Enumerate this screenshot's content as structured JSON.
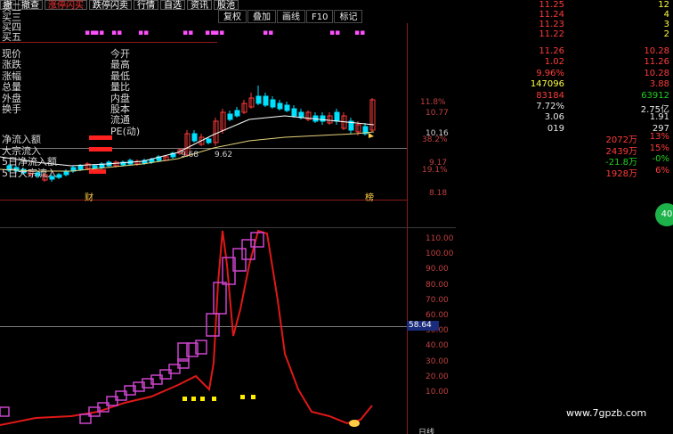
{
  "toolbar": {
    "buttons": [
      {
        "label": "撤",
        "red": false
      },
      {
        "label": "撤查",
        "red": false
      },
      {
        "label": "涨停闪买",
        "red": true
      },
      {
        "label": "跌停闪卖",
        "red": false
      },
      {
        "label": "行情",
        "red": false
      },
      {
        "label": "自选",
        "red": false
      },
      {
        "label": "资讯",
        "red": false
      },
      {
        "label": "股池",
        "red": false
      }
    ],
    "sub_buttons": [
      "复权",
      "叠加",
      "画线",
      "F10",
      "标记"
    ]
  },
  "price_axis": [
    "11.8%",
    "10.77",
    "10.16",
    "38.2%",
    "9.17",
    "19.1%",
    "8.18"
  ],
  "ma_labels": [
    "9.68",
    "9.62"
  ],
  "markers": {
    "left": "财",
    "right": "榜"
  },
  "lower_axis": [
    "110.00",
    "100.00",
    "90.00",
    "80.00",
    "70.00",
    "60.00",
    "50.00",
    "40.00",
    "30.00",
    "20.00",
    "10.00"
  ],
  "lower_highlight": "58.64",
  "lower_footer": "日线",
  "quote": {
    "bids": [
      {
        "label": "买二",
        "price": "11.25",
        "vol": "12"
      },
      {
        "label": "买三",
        "price": "11.24",
        "vol": "4"
      },
      {
        "label": "买四",
        "price": "11.23",
        "vol": "3"
      },
      {
        "label": "买五",
        "price": "11.22",
        "vol": "2"
      }
    ],
    "rows": [
      {
        "l1": "现价",
        "v1": "11.26",
        "c1": "red",
        "l2": "今开",
        "v2": "10.28",
        "c2": "red"
      },
      {
        "l1": "涨跌",
        "v1": "1.02",
        "c1": "red",
        "l2": "最高",
        "v2": "11.26",
        "c2": "red"
      },
      {
        "l1": "涨幅",
        "v1": "9.96%",
        "c1": "red",
        "l2": "最低",
        "v2": "10.28",
        "c2": "red"
      },
      {
        "l1": "总量",
        "v1": "147096",
        "c1": "yellow",
        "l2": "量比",
        "v2": "3.88",
        "c2": "red"
      },
      {
        "l1": "外盘",
        "v1": "83184",
        "c1": "red",
        "l2": "内盘",
        "v2": "63912",
        "c2": "green"
      },
      {
        "l1": "换手",
        "v1": "7.72%",
        "c1": "white",
        "l2": "股本",
        "v2": "2.75亿",
        "c2": "white"
      },
      {
        "l1": "",
        "v1": "3.06",
        "c1": "white",
        "l2": "流通",
        "v2": "1.91",
        "c2": "white"
      },
      {
        "l1": "",
        "v1": "019",
        "c1": "white",
        "l2": "PE(动)",
        "v2": "297",
        "c2": "white"
      }
    ],
    "flows": [
      {
        "label": "净流入额",
        "value": "2072万",
        "pct": "13%",
        "bar": 0.55
      },
      {
        "label": "大宗流入",
        "value": "2439万",
        "pct": "15%",
        "bar": 0.55
      },
      {
        "label": "5日净流入额",
        "value": "-21.8万",
        "pct": "-0%",
        "bar": 0.0
      },
      {
        "label": "5日大宗流入",
        "value": "1928万",
        "pct": "6%",
        "bar": 0.4
      }
    ],
    "badge": "40"
  },
  "watermark": "www.7gpzb.com",
  "colors": {
    "up": "#ff3b3b",
    "down": "#00e0ff",
    "ma1": "#ffffff",
    "ma2": "#e6d37a",
    "line": "#e01818",
    "box": "#cc44cc",
    "bar": "#ffee00"
  }
}
